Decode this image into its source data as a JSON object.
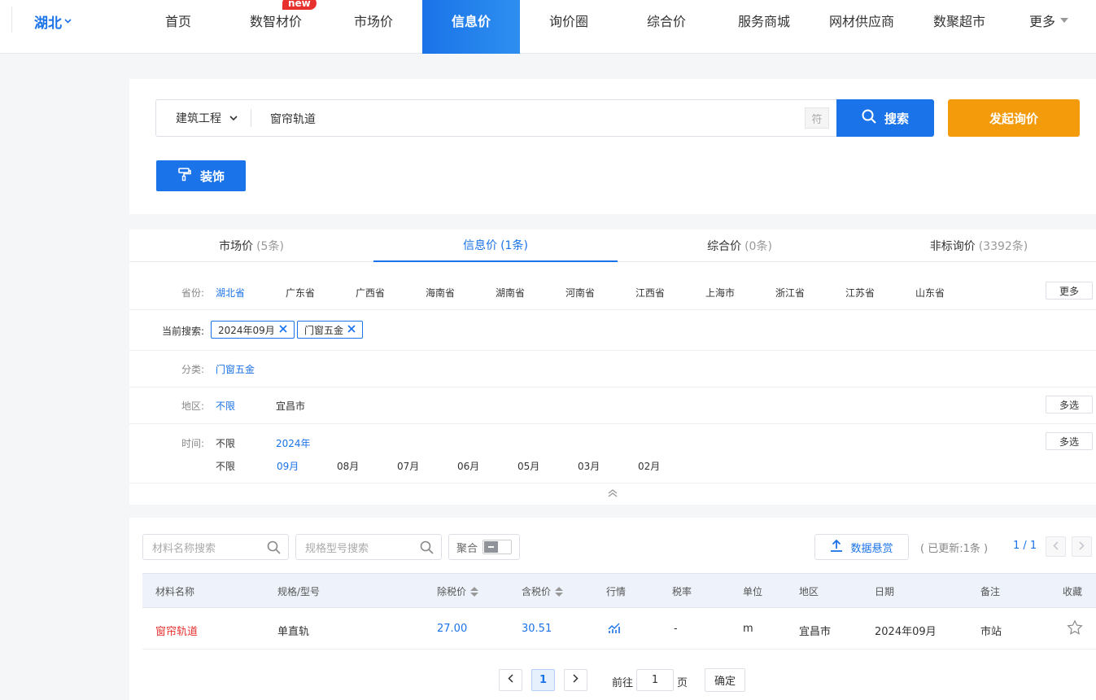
{
  "nav": {
    "region": "湖北",
    "items": [
      "首页",
      "数智材价",
      "市场价",
      "信息价",
      "询价圈",
      "综合价",
      "服务商城",
      "网材供应商",
      "数聚超市",
      "更多"
    ],
    "new_badge": "new"
  },
  "search": {
    "category": "建筑工程",
    "keyword": "窗帘轨道",
    "symbol_btn": "符",
    "search_btn": "搜索",
    "inquiry_btn": "发起询价",
    "deco_btn": "装饰"
  },
  "tabs": [
    {
      "label": "市场价",
      "count": "(5条)"
    },
    {
      "label": "信息价",
      "count": "(1条)"
    },
    {
      "label": "综合价",
      "count": "(0条)"
    },
    {
      "label": "非标询价",
      "count": "(3392条)"
    }
  ],
  "filters": {
    "province_label": "省份:",
    "provinces": [
      "湖北省",
      "广东省",
      "广西省",
      "海南省",
      "湖南省",
      "河南省",
      "江西省",
      "上海市",
      "浙江省",
      "江苏省",
      "山东省"
    ],
    "more_btn": "更多",
    "current_label": "当前搜索:",
    "current_tags": [
      "2024年09月",
      "门窗五金"
    ],
    "category_label": "分类:",
    "category_value": "门窗五金",
    "area_label": "地区:",
    "area_values": [
      "不限",
      "宜昌市"
    ],
    "multi_btn": "多选",
    "time_label": "时间:",
    "years": [
      "不限",
      "2024年"
    ],
    "months": [
      "不限",
      "09月",
      "08月",
      "07月",
      "06月",
      "05月",
      "03月",
      "02月"
    ],
    "multi_btn2": "多选"
  },
  "results": {
    "name_placeholder": "材料名称搜索",
    "spec_placeholder": "规格型号搜索",
    "aggregate": "聚合",
    "reward_btn": "数据悬赏",
    "updated": "( 已更新:1条 )",
    "page_info": "1 / 1",
    "columns": [
      "材料名称",
      "规格/型号",
      "除税价",
      "含税价",
      "行情",
      "税率",
      "单位",
      "地区",
      "日期",
      "备注",
      "收藏"
    ],
    "rows": [
      {
        "name": "窗帘轨道",
        "spec": "单直轨",
        "pre_tax": "27.00",
        "with_tax": "30.51",
        "tax_rate": "-",
        "unit": "m",
        "area": "宜昌市",
        "date": "2024年09月",
        "note": "市站"
      }
    ],
    "pager": {
      "current": "1",
      "goto_prefix": "前往",
      "goto_value": "1",
      "goto_suffix": "页",
      "confirm": "确定"
    }
  },
  "colors": {
    "accent": "#1a73e8",
    "orange": "#f49b0b",
    "red": "#e6312f"
  }
}
